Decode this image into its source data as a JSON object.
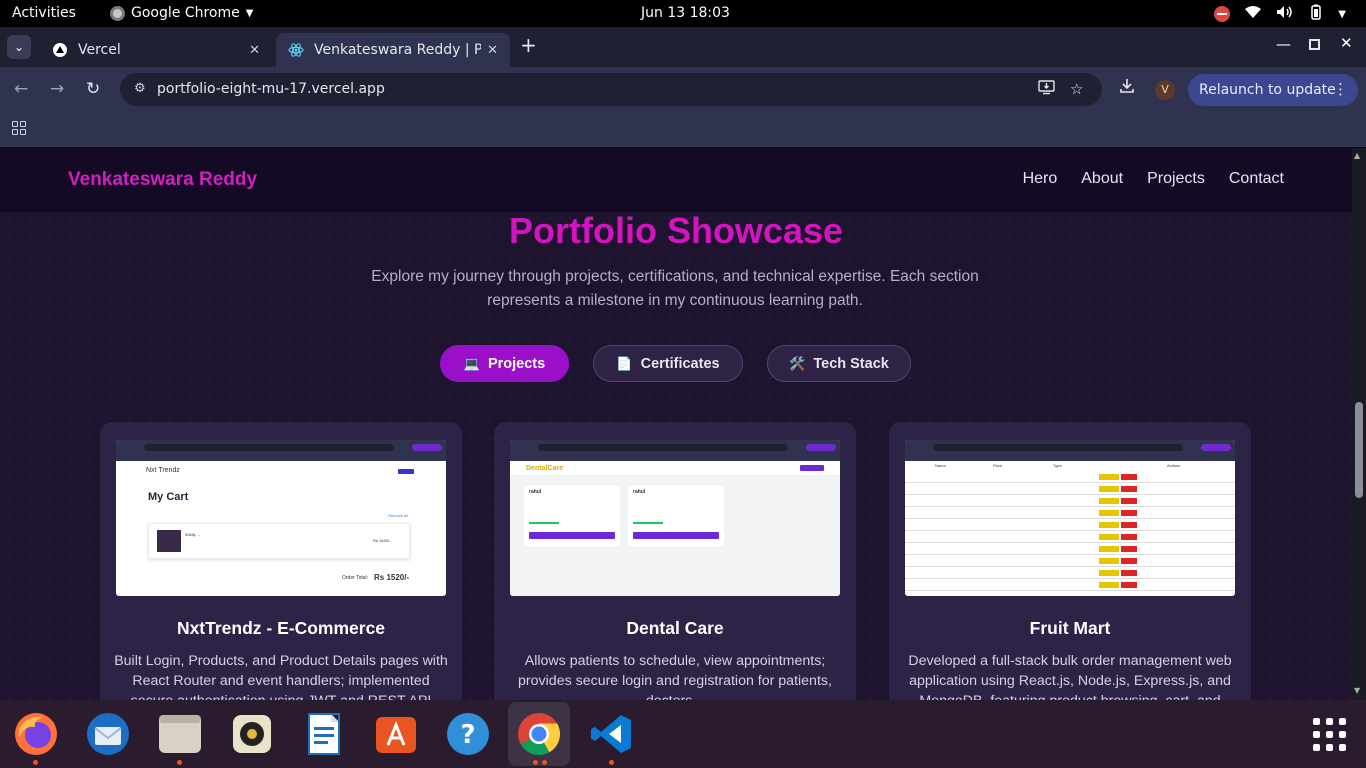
{
  "topbar": {
    "activities": "Activities",
    "app_name": "Google Chrome",
    "clock": "Jun 13  18:03"
  },
  "tabs": [
    {
      "label": "Vercel",
      "icon": "vercel-icon"
    },
    {
      "label": "Venkateswara Reddy | Po",
      "icon": "react-icon"
    }
  ],
  "toolbar": {
    "url": "portfolio-eight-mu-17.vercel.app",
    "avatar": "V",
    "relaunch": "Relaunch to update"
  },
  "site": {
    "brand": "Venkateswara Reddy",
    "nav": [
      "Hero",
      "About",
      "Projects",
      "Contact"
    ],
    "heading": "Portfolio Showcase",
    "subtext": "Explore my journey through projects, certifications, and technical expertise. Each section represents a milestone in my continuous learning path.",
    "tabs": [
      {
        "icon": "💻",
        "label": "Projects",
        "active": true
      },
      {
        "icon": "📄",
        "label": "Certificates",
        "active": false
      },
      {
        "icon": "🛠️",
        "label": "Tech Stack",
        "active": false
      }
    ],
    "cards": [
      {
        "title": "NxtTrendz - E-Commerce",
        "desc": "Built Login, Products, and Product Details pages with React Router and event handlers; implemented secure authentication using JWT and REST API calls.",
        "shot": {
          "logo": "Nxt Trendz",
          "heading": "My Cart",
          "link": "Remove all",
          "item": "Wildly ... ",
          "price": "Rs 1520/-",
          "total": "Order Total:"
        }
      },
      {
        "title": "Dental Care",
        "desc": "Allows patients to schedule, view appointments; provides secure login and registration for patients, doctors...",
        "shot": {
          "logo": "DentalCare",
          "name1": "rahul",
          "name2": "rahul"
        }
      },
      {
        "title": "Fruit Mart",
        "desc": "Developed a full-stack bulk order management web application using React.js, Node.js, Express.js, and MongoDB, featuring product browsing, cart, and",
        "shot": {
          "col1": "Name",
          "col2": "Price",
          "col3": "Type",
          "col4": "Actions"
        }
      }
    ]
  },
  "colors": {
    "accent": "#d414bf",
    "active_pill": "#9a10c9",
    "page_bg": "#1e1430",
    "card_bg": "#2c2347"
  },
  "dock": [
    "firefox-icon",
    "thunderbird-icon",
    "files-icon",
    "rhythmbox-icon",
    "writer-icon",
    "app-center-icon",
    "help-icon",
    "chrome-icon",
    "vscode-icon",
    "show-apps-icon"
  ]
}
